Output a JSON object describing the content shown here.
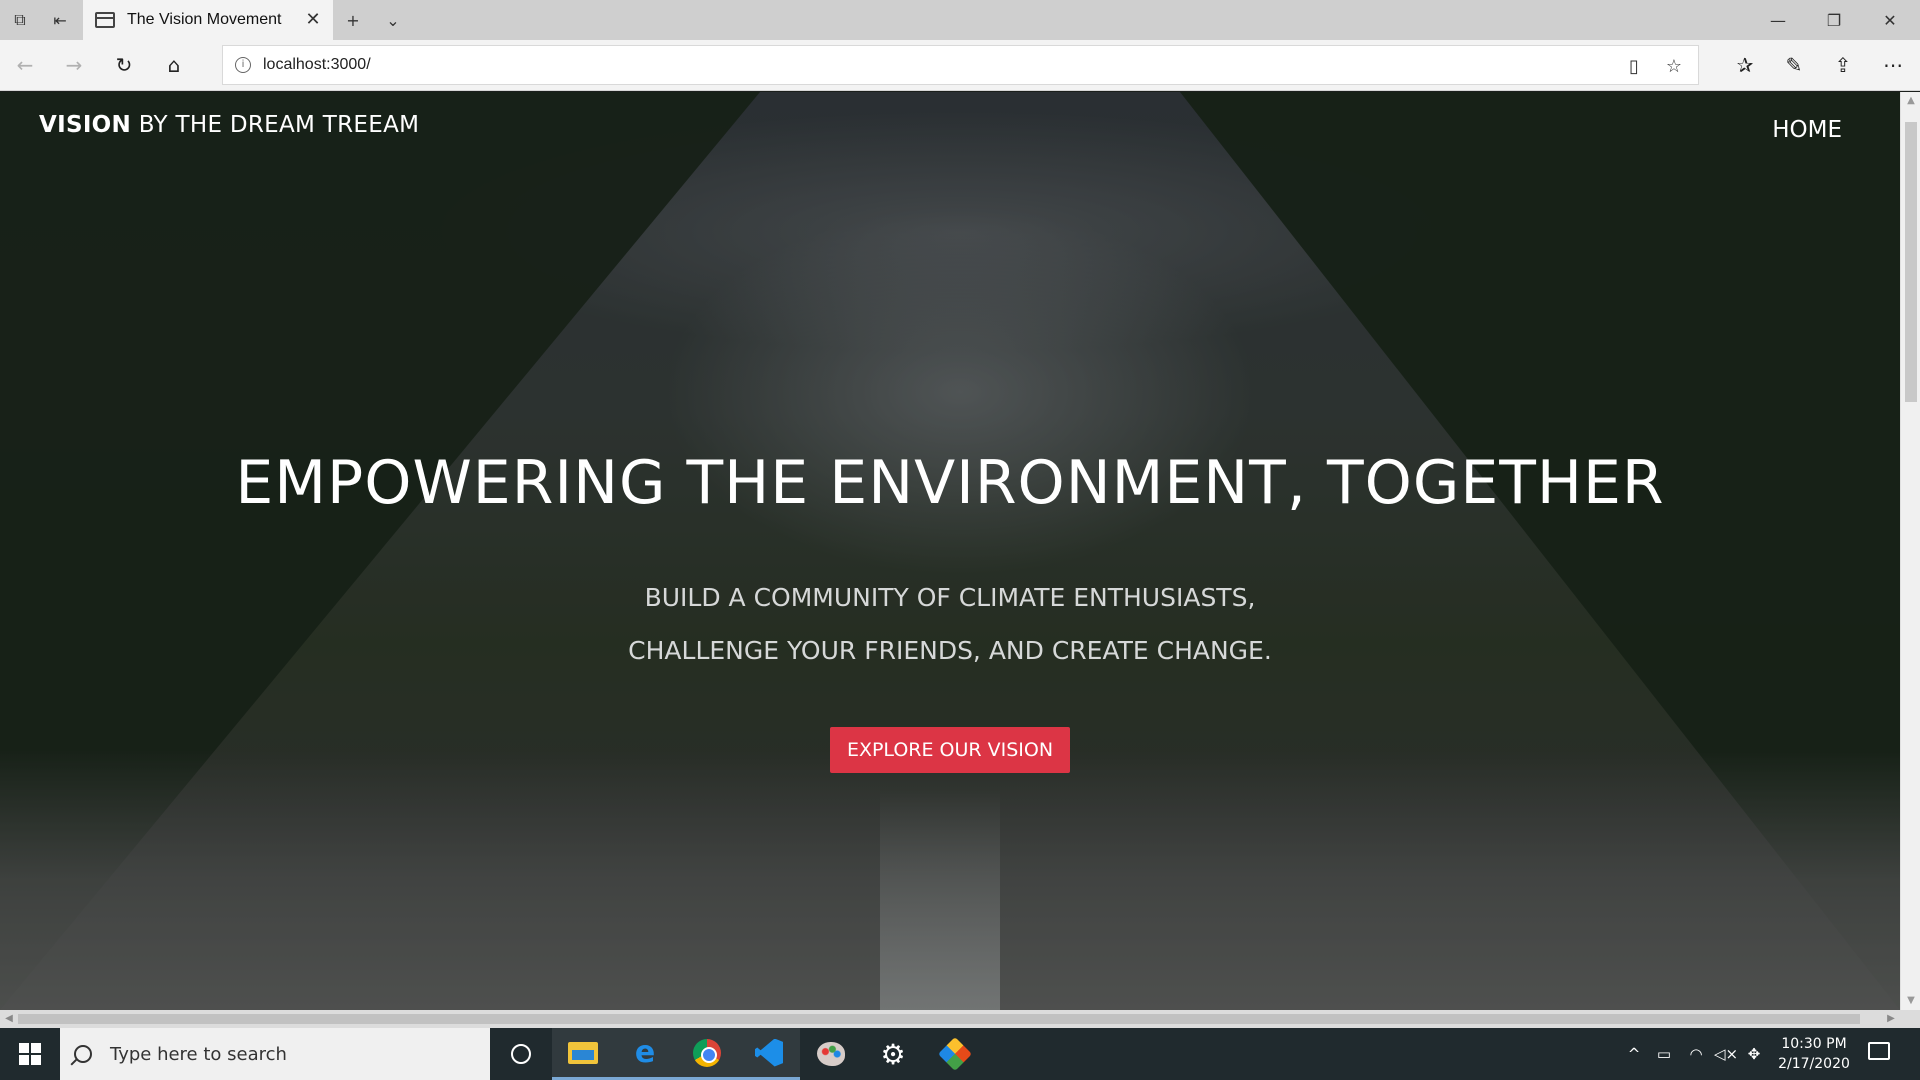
{
  "browser": {
    "tab_title": "The Vision Movement",
    "url": "localhost:3000/"
  },
  "page": {
    "brand_bold": "VISION",
    "brand_rest": "BY THE DREAM TREEAM",
    "nav_home": "HOME",
    "hero_title": "EMPOWERING THE ENVIRONMENT, TOGETHER",
    "hero_sub_line1": "BUILD A COMMUNITY OF CLIMATE ENTHUSIASTS,",
    "hero_sub_line2": "CHALLENGE YOUR FRIENDS, AND CREATE CHANGE.",
    "cta_label": "EXPLORE OUR VISION",
    "cta_color": "#dc3545"
  },
  "taskbar": {
    "search_placeholder": "Type here to search",
    "time": "10:30 PM",
    "date": "2/17/2020",
    "pinned": [
      "cortana-icon",
      "file-explorer-icon",
      "edge-icon",
      "chrome-icon",
      "vscode-icon",
      "paint-icon",
      "settings-icon",
      "git-icon"
    ]
  }
}
